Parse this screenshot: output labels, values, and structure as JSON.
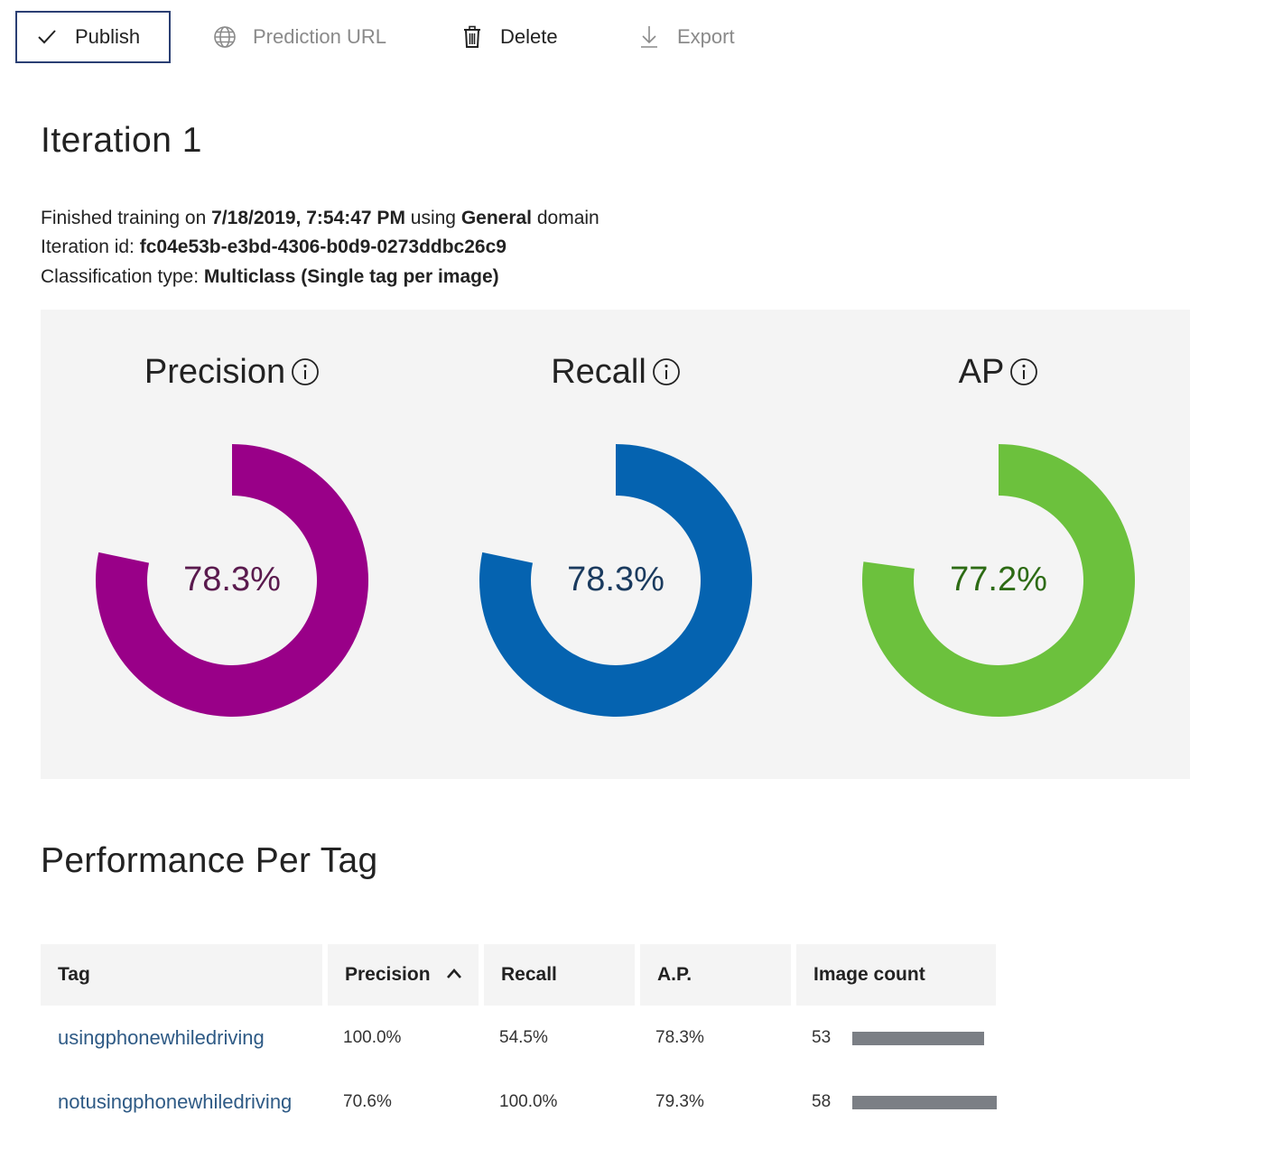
{
  "toolbar": {
    "publish_label": "Publish",
    "prediction_url_label": "Prediction URL",
    "delete_label": "Delete",
    "export_label": "Export"
  },
  "page_title": "Iteration 1",
  "info": {
    "training_prefix": "Finished training on ",
    "training_date": "7/18/2019, 7:54:47 PM",
    "training_mid": " using ",
    "domain": "General",
    "training_suffix": " domain",
    "iteration_id_label": "Iteration id: ",
    "iteration_id": "fc04e53b-e3bd-4306-b0d9-0273ddbc26c9",
    "classification_label": "Classification type: ",
    "classification_type": "Multiclass (Single tag per image)"
  },
  "metrics": [
    {
      "title": "Precision",
      "value_text": "78.3%",
      "fraction": 0.783,
      "color": "#990088",
      "text_color": "#5a1a4e"
    },
    {
      "title": "Recall",
      "value_text": "78.3%",
      "fraction": 0.783,
      "color": "#0563b0",
      "text_color": "#1a3a5e"
    },
    {
      "title": "AP",
      "value_text": "77.2%",
      "fraction": 0.772,
      "color": "#6cc13d",
      "text_color": "#2d6b14"
    }
  ],
  "section_title": "Performance Per Tag",
  "table": {
    "columns": [
      "Tag",
      "Precision",
      "Recall",
      "A.P.",
      "Image count"
    ],
    "sorted_column": "Precision",
    "rows": [
      {
        "tag": "usingphonewhiledriving",
        "precision": "100.0%",
        "recall": "54.5%",
        "ap": "78.3%",
        "count": "53",
        "count_value": 53
      },
      {
        "tag": "notusingphonewhiledriving",
        "precision": "70.6%",
        "recall": "100.0%",
        "ap": "79.3%",
        "count": "58",
        "count_value": 58
      }
    ]
  }
}
